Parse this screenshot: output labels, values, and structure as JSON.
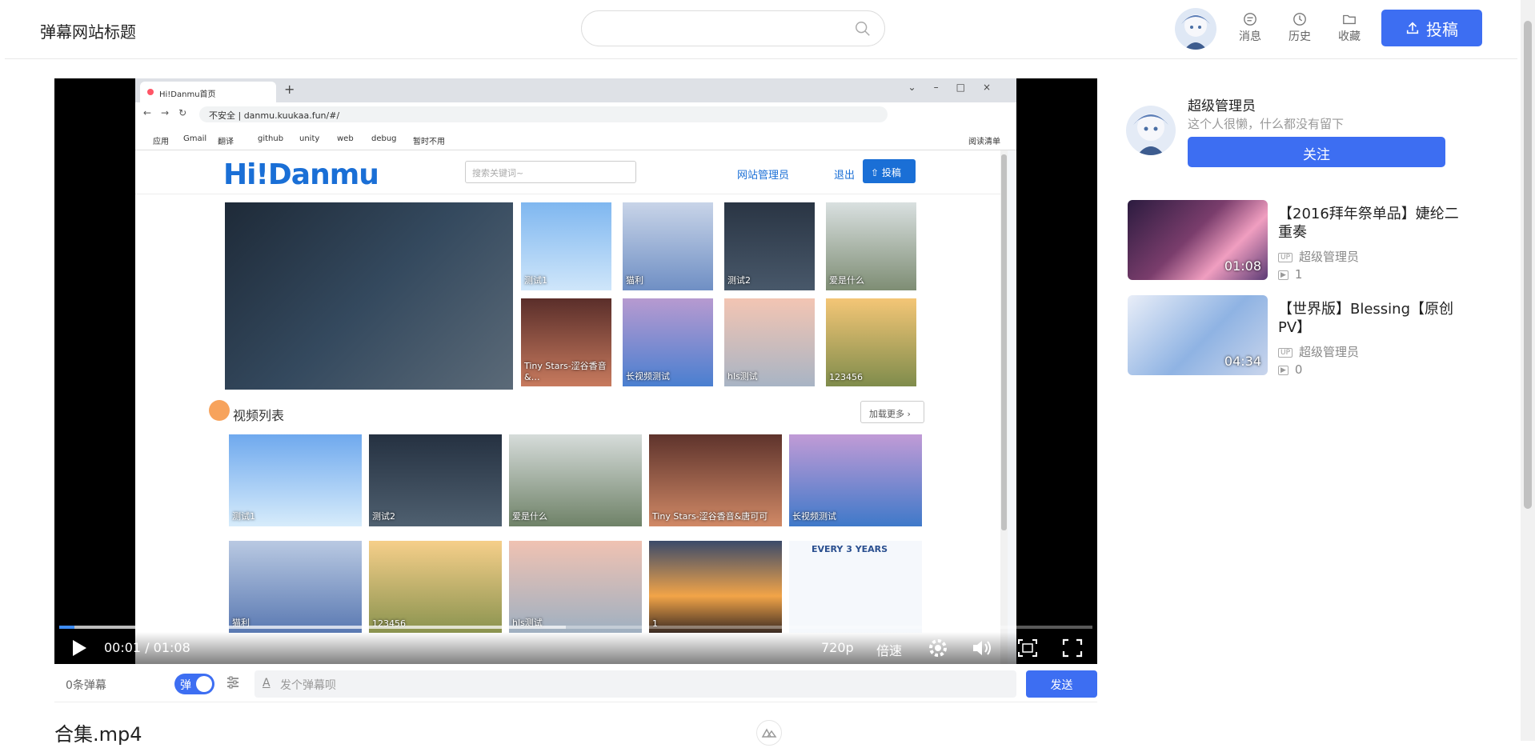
{
  "header": {
    "site_title": "弹幕网站标题",
    "nav": [
      "消息",
      "历史",
      "收藏"
    ],
    "upload_label": "投稿"
  },
  "player": {
    "time": "00:01 / 01:08",
    "quality": "720p",
    "speed": "倍速",
    "progress_fraction": 0.015,
    "buffered_fraction": 0.49,
    "screenshot": {
      "tab_title": "Hi!Danmu首页",
      "url": "不安全 | danmu.kuukaa.fun/#/",
      "bookmarks": [
        "应用",
        "Gmail",
        "翻译",
        "github",
        "unity",
        "web",
        "debug",
        "暂时不用"
      ],
      "reading_list": "阅读清单",
      "site_logo": "Hi!Danmu",
      "search_placeholder": "搜索关键词~",
      "username": "网站管理员",
      "logout": "退出",
      "upload": "投稿",
      "grid_labels": [
        "测试1",
        "猫利",
        "测试2",
        "爱是什么",
        "Tiny Stars-涩谷香音&…",
        "长视频测试",
        "hls测试",
        "123456"
      ],
      "section_title": "视频列表",
      "load_more": "加载更多",
      "row1": [
        "测试1",
        "测试2",
        "爱是什么",
        "Tiny Stars-涩谷香音&唐可可",
        "长视频测试"
      ],
      "row2": [
        "猫利",
        "123456",
        "hls测试",
        "1",
        "EVERY 3 YEARS"
      ]
    }
  },
  "danmaku": {
    "count": "0条弹幕",
    "toggle": "弹",
    "placeholder": "发个弹幕呗",
    "send": "发送"
  },
  "video_title": "合集.mp4",
  "uploader": {
    "name": "超级管理员",
    "desc": "这个人很懒，什么都没有留下",
    "follow": "关注"
  },
  "recommendations": [
    {
      "title": "【2016拜年祭单品】婕纶二重奏",
      "duration": "01:08",
      "up": "超级管理员",
      "plays": "1"
    },
    {
      "title": "【世界版】Blessing【原创PV】",
      "duration": "04:34",
      "up": "超级管理员",
      "plays": "0"
    }
  ],
  "colors": {
    "accent": "#3d6ef2"
  }
}
